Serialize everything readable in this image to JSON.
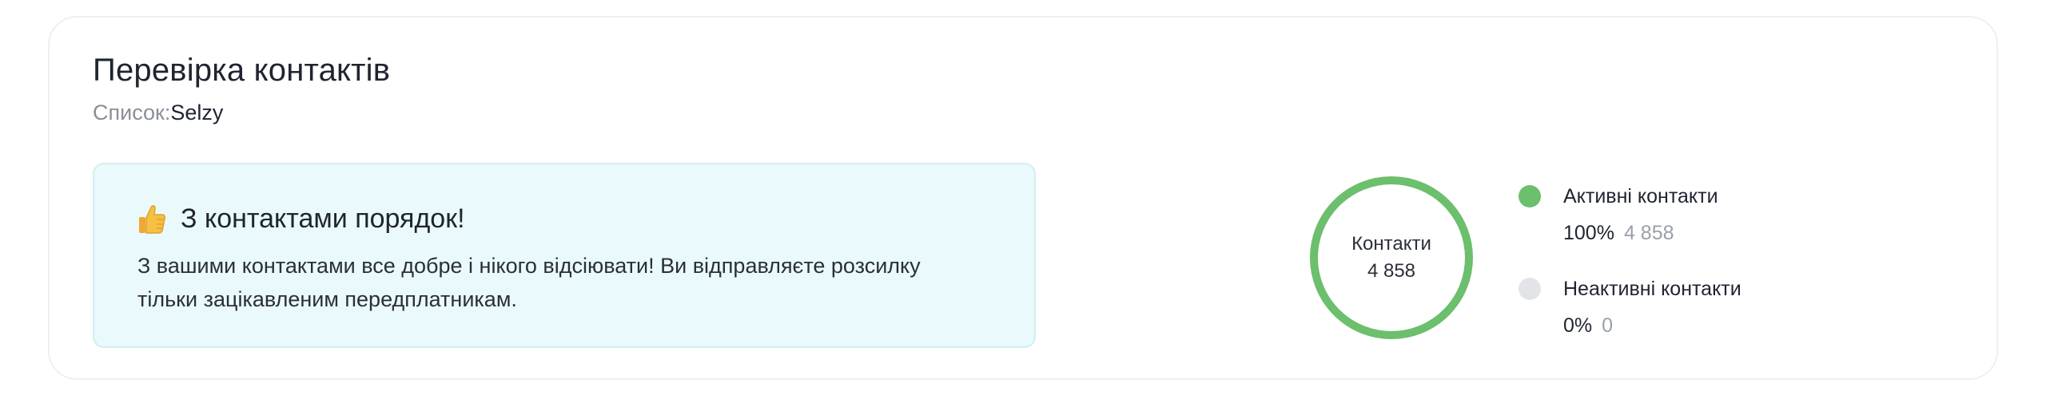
{
  "header": {
    "title": "Перевірка контактів",
    "list_label": "Список:",
    "list_value": "Selzy"
  },
  "notice": {
    "icon": "thumbs-up-icon",
    "title": "З контактами порядок!",
    "text": "З вашими контактами все добре і нікого відсіювати! Ви відправляєте розсилку тільки зацікавленим передплатникам."
  },
  "donut": {
    "label": "Контакти",
    "total": "4 858"
  },
  "legend": [
    {
      "name": "Активні контакти",
      "percent": "100%",
      "count": "4 858",
      "color": "#6cbf6c"
    },
    {
      "name": "Неактивні контакти",
      "percent": "0%",
      "count": "0",
      "color": "#e3e4e8"
    }
  ],
  "chart_data": {
    "type": "pie",
    "categories": [
      "Активні контакти",
      "Неактивні контакти"
    ],
    "values": [
      4858,
      0
    ],
    "percents": [
      100,
      0
    ]
  },
  "colors": {
    "active": "#6cbf6c",
    "inactive": "#e3e4e8",
    "notice_bg": "#eaf9fb",
    "notice_border": "#d3eef2"
  }
}
